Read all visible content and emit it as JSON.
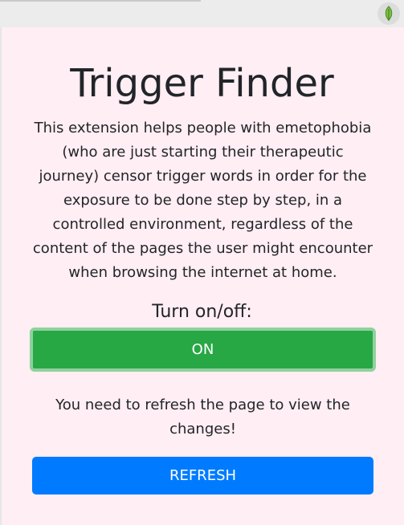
{
  "browser": {
    "extension_icon": "leaf-icon"
  },
  "popup": {
    "title": "Trigger Finder",
    "description": "This extension helps people with emetophobia (who are just starting their therapeutic journey) censor trigger words in order for the exposure to be done step by step, in a controlled environment, regardless of the content of the pages the user might encounter when browsing the internet at home.",
    "toggle_label": "Turn on/off:",
    "toggle_button_label": "ON",
    "refresh_note": "You need to refresh the page to view the changes!",
    "refresh_button_label": "REFRESH"
  },
  "colors": {
    "background": "#ffeef3",
    "on_button": "#28a745",
    "refresh_button": "#007bff",
    "text": "#212529"
  }
}
